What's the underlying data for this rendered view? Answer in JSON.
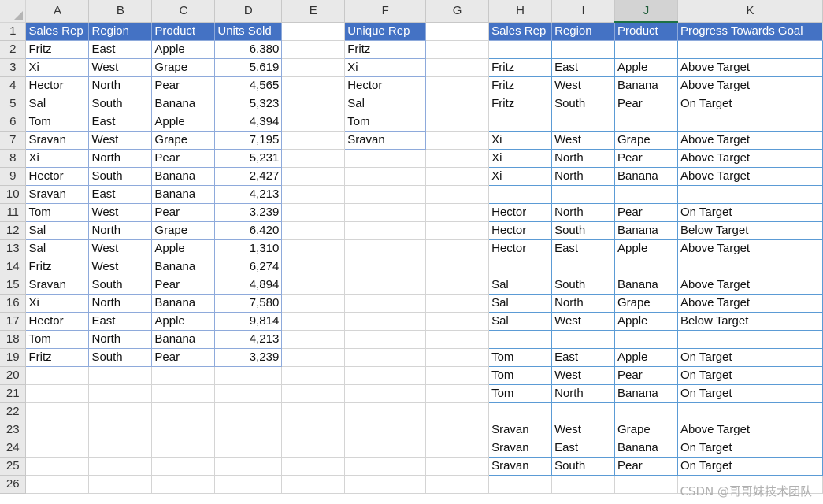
{
  "spreadsheet": {
    "columns": [
      "A",
      "B",
      "C",
      "D",
      "E",
      "F",
      "G",
      "H",
      "I",
      "J",
      "K"
    ],
    "active_column": "J",
    "row_numbers": [
      "1",
      "2",
      "3",
      "4",
      "5",
      "6",
      "7",
      "8",
      "9",
      "10",
      "11",
      "12",
      "13",
      "14",
      "15",
      "16",
      "17",
      "18",
      "19",
      "20",
      "21",
      "22",
      "23",
      "24",
      "25",
      "26"
    ],
    "sales_table": {
      "headers": [
        "Sales Rep",
        "Region",
        "Product",
        "Units Sold"
      ],
      "rows": [
        [
          "Fritz",
          "East",
          "Apple",
          "6,380"
        ],
        [
          "Xi",
          "West",
          "Grape",
          "5,619"
        ],
        [
          "Hector",
          "North",
          "Pear",
          "4,565"
        ],
        [
          "Sal",
          "South",
          "Banana",
          "5,323"
        ],
        [
          "Tom",
          "East",
          "Apple",
          "4,394"
        ],
        [
          "Sravan",
          "West",
          "Grape",
          "7,195"
        ],
        [
          "Xi",
          "North",
          "Pear",
          "5,231"
        ],
        [
          "Hector",
          "South",
          "Banana",
          "2,427"
        ],
        [
          "Sravan",
          "East",
          "Banana",
          "4,213"
        ],
        [
          "Tom",
          "West",
          "Pear",
          "3,239"
        ],
        [
          "Sal",
          "North",
          "Grape",
          "6,420"
        ],
        [
          "Sal",
          "West",
          "Apple",
          "1,310"
        ],
        [
          "Fritz",
          "West",
          "Banana",
          "6,274"
        ],
        [
          "Sravan",
          "South",
          "Pear",
          "4,894"
        ],
        [
          "Xi",
          "North",
          "Banana",
          "7,580"
        ],
        [
          "Hector",
          "East",
          "Apple",
          "9,814"
        ],
        [
          "Tom",
          "North",
          "Banana",
          "4,213"
        ],
        [
          "Fritz",
          "South",
          "Pear",
          "3,239"
        ]
      ]
    },
    "unique_rep": {
      "header": "Unique Rep",
      "values": [
        "Fritz",
        "Xi",
        "Hector",
        "Sal",
        "Tom",
        "Sravan"
      ]
    },
    "progress_table": {
      "headers": [
        "Sales Rep",
        "Region",
        "Product",
        "Progress Towards Goal"
      ],
      "rows": [
        [
          "",
          "",
          "",
          ""
        ],
        [
          "Fritz",
          "East",
          "Apple",
          "Above Target"
        ],
        [
          "Fritz",
          "West",
          "Banana",
          "Above Target"
        ],
        [
          "Fritz",
          "South",
          "Pear",
          "On Target"
        ],
        [
          "",
          "",
          "",
          ""
        ],
        [
          "Xi",
          "West",
          "Grape",
          "Above Target"
        ],
        [
          "Xi",
          "North",
          "Pear",
          "Above Target"
        ],
        [
          "Xi",
          "North",
          "Banana",
          "Above Target"
        ],
        [
          "",
          "",
          "",
          ""
        ],
        [
          "Hector",
          "North",
          "Pear",
          "On Target"
        ],
        [
          "Hector",
          "South",
          "Banana",
          "Below Target"
        ],
        [
          "Hector",
          "East",
          "Apple",
          "Above Target"
        ],
        [
          "",
          "",
          "",
          ""
        ],
        [
          "Sal",
          "South",
          "Banana",
          "Above Target"
        ],
        [
          "Sal",
          "North",
          "Grape",
          "Above Target"
        ],
        [
          "Sal",
          "West",
          "Apple",
          "Below Target"
        ],
        [
          "",
          "",
          "",
          ""
        ],
        [
          "Tom",
          "East",
          "Apple",
          "On Target"
        ],
        [
          "Tom",
          "West",
          "Pear",
          "On Target"
        ],
        [
          "Tom",
          "North",
          "Banana",
          "On Target"
        ],
        [
          "",
          "",
          "",
          ""
        ],
        [
          "Sravan",
          "West",
          "Grape",
          "Above Target"
        ],
        [
          "Sravan",
          "East",
          "Banana",
          "On Target"
        ],
        [
          "Sravan",
          "South",
          "Pear",
          "On Target"
        ]
      ]
    },
    "watermark": "CSDN @哥哥妹技术团队"
  },
  "colors": {
    "header_fill": "#4472c4",
    "header_text": "#ffffff",
    "group_border": "#5b9bd5",
    "active_column_accent": "#1e7145"
  }
}
